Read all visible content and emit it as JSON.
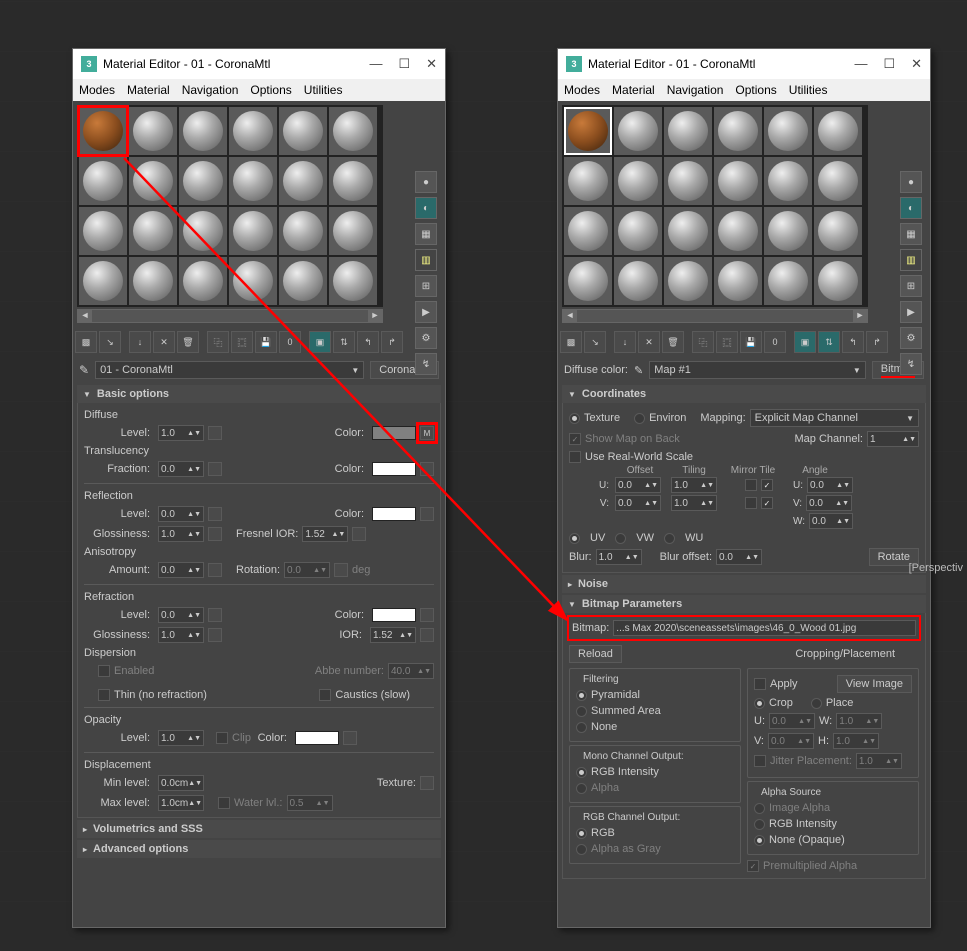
{
  "win": {
    "title": "Material Editor - 01 - CoronaMtl",
    "icon_label": "3"
  },
  "menu": [
    "Modes",
    "Material",
    "Navigation",
    "Options",
    "Utilities"
  ],
  "mat_name": "01 - CoronaMtl",
  "mat_type": "CoronaMtl",
  "rollouts": {
    "basic": "Basic options",
    "vol": "Volumetrics and SSS",
    "adv": "Advanced options",
    "coords": "Coordinates",
    "noise": "Noise",
    "bmp": "Bitmap Parameters"
  },
  "labels": {
    "diffuse": "Diffuse",
    "level": "Level:",
    "color": "Color:",
    "translucency": "Translucency",
    "fraction": "Fraction:",
    "reflection": "Reflection",
    "glossiness": "Glossiness:",
    "fresnel": "Fresnel IOR:",
    "anisotropy": "Anisotropy",
    "amount": "Amount:",
    "rotation": "Rotation:",
    "deg": "deg",
    "refraction": "Refraction",
    "ior": "IOR:",
    "dispersion": "Dispersion",
    "enabled": "Enabled",
    "abbe": "Abbe number:",
    "thin": "Thin (no refraction)",
    "caustics": "Caustics (slow)",
    "opacity": "Opacity",
    "clip": "Clip",
    "displacement": "Displacement",
    "minlevel": "Min level:",
    "maxlevel": "Max level:",
    "texture": "Texture:",
    "waterlvl": "Water lvl.:",
    "m": "M",
    "diffuse_color": "Diffuse color:",
    "mapname": "Map #1",
    "bitmap_type": "Bitmap",
    "mapping": "Mapping:",
    "explicit": "Explicit Map Channel",
    "texture_rb": "Texture",
    "environ_rb": "Environ",
    "show_map": "Show Map on Back",
    "map_channel": "Map Channel:",
    "real_world": "Use Real-World Scale",
    "offset": "Offset",
    "tiling": "Tiling",
    "mirror_tile": "Mirror Tile",
    "angle": "Angle",
    "u": "U:",
    "v": "V:",
    "w": "W:",
    "uv": "UV",
    "vw": "VW",
    "wu": "WU",
    "blur": "Blur:",
    "blur_offset": "Blur offset:",
    "rotate": "Rotate",
    "bitmap": "Bitmap:",
    "bitmap_path": "...s Max 2020\\sceneassets\\images\\46_0_Wood 01.jpg",
    "reload": "Reload",
    "filtering": "Filtering",
    "pyramidal": "Pyramidal",
    "summed": "Summed Area",
    "none": "None",
    "mono_output": "Mono Channel Output:",
    "rgb_intensity": "RGB Intensity",
    "alpha": "Alpha",
    "rgb_output": "RGB Channel Output:",
    "rgb": "RGB",
    "alpha_gray": "Alpha as Gray",
    "crop_place": "Cropping/Placement",
    "apply": "Apply",
    "view_image": "View Image",
    "crop": "Crop",
    "place": "Place",
    "h": "H:",
    "jitter": "Jitter Placement:",
    "alpha_source": "Alpha Source",
    "image_alpha": "Image Alpha",
    "none_opaque": "None (Opaque)",
    "premult": "Premultiplied Alpha"
  },
  "vals": {
    "one": "1.0",
    "zero": "0.0",
    "ior": "1.52",
    "abbe": "40.0",
    "disp_min": "0.0cm",
    "disp_max": "1.0cm",
    "water": "0.5",
    "map_channel": "1",
    "jitter": "1.0"
  },
  "perspective": "[Perspectiv"
}
